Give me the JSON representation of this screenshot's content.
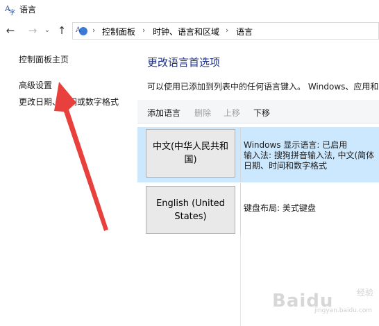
{
  "window": {
    "title": "语言"
  },
  "address": {
    "items": [
      "控制面板",
      "时钟、语言和区域",
      "语言"
    ],
    "separator": "›"
  },
  "nav": {
    "back": "←",
    "forward": "→",
    "recent": "⌄",
    "up": "↑"
  },
  "left_pane": {
    "links": [
      "控制面板主页",
      "高级设置",
      "更改日期、时间或数字格式"
    ]
  },
  "main": {
    "title": "更改语言首选项",
    "description": "可以使用已添加到列表中的任何语言键入。 Windows、应用和",
    "toolbar": {
      "add": "添加语言",
      "remove": "删除",
      "move_up": "上移",
      "move_down": "下移"
    },
    "languages": [
      {
        "name": "中文(中华人民共和国)",
        "info": [
          "Windows 显示语言: 已启用",
          "输入法: 搜狗拼音输入法, 中文(简体",
          "日期、时间和数字格式"
        ]
      },
      {
        "name": "English (United States)",
        "info": [
          "键盘布局: 美式键盘"
        ]
      }
    ]
  },
  "watermark": {
    "text": "Baidu",
    "sub": "经验",
    "url": "jingyan.baidu.com"
  },
  "colors": {
    "accent": "#1e3287",
    "selected_row": "#cce8ff",
    "arrow": "#e8403c"
  }
}
